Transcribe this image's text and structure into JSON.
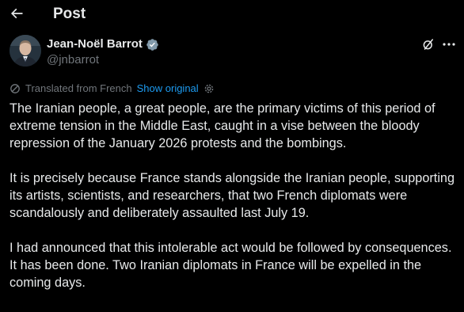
{
  "header": {
    "title": "Post"
  },
  "author": {
    "name": "Jean-Noël Barrot",
    "handle": "@jnbarrot"
  },
  "translation": {
    "label": "Translated from French",
    "show_original": "Show original"
  },
  "post": {
    "paragraphs": [
      "The Iranian people, a great people, are the primary victims of this period of extreme tension in the Middle East, caught in a vise between the bloody repression of the January 2026 protests and the bombings.",
      "It is precisely because France stands alongside the Iranian people, supporting its artists, scientists, and researchers, that two French diplomats were scandalously and deliberately assaulted last July 19.",
      "I had announced that this intolerable act would be followed by consequences. It has been done. Two Iranian diplomats in France will be expelled in the coming days."
    ]
  },
  "colors": {
    "background": "#000000",
    "text_primary": "#e7e9ea",
    "text_secondary": "#71767b",
    "link": "#1d9bf0",
    "verified": "#829aab"
  },
  "icons": {
    "back": "arrow-left-icon",
    "verified": "verified-badge-icon",
    "grok": "grok-icon",
    "more": "more-horizontal-icon",
    "translate": "translate-icon",
    "settings": "gear-icon"
  }
}
